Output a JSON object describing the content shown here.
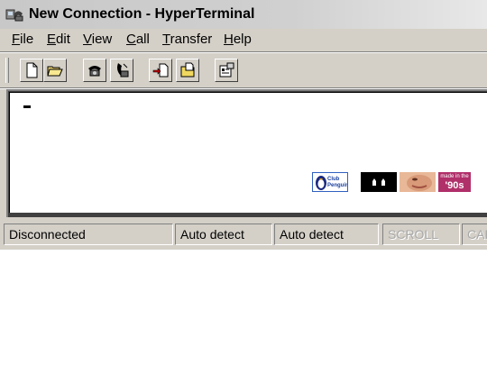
{
  "window": {
    "title": "New Connection - HyperTerminal",
    "app_icon": "hyperterminal-phone-icon"
  },
  "menubar": {
    "items": [
      {
        "label": "File",
        "accelerator": "F",
        "rest": "ile"
      },
      {
        "label": "Edit",
        "accelerator": "E",
        "rest": "dit"
      },
      {
        "label": "View",
        "accelerator": "V",
        "rest": "iew"
      },
      {
        "label": "Call",
        "accelerator": "C",
        "rest": "all"
      },
      {
        "label": "Transfer",
        "accelerator": "T",
        "rest": "ransfer"
      },
      {
        "label": "Help",
        "accelerator": "H",
        "rest": "elp"
      }
    ]
  },
  "toolbar": {
    "buttons": [
      {
        "name": "new-connection-button",
        "icon": "new-document-icon"
      },
      {
        "name": "open-button",
        "icon": "open-folder-icon"
      },
      {
        "name": "call-button",
        "icon": "phone-icon"
      },
      {
        "name": "disconnect-button",
        "icon": "hangup-phone-icon"
      },
      {
        "name": "send-file-button",
        "icon": "send-file-icon"
      },
      {
        "name": "receive-file-button",
        "icon": "receive-file-icon"
      },
      {
        "name": "properties-button",
        "icon": "properties-icon"
      }
    ]
  },
  "terminal": {
    "badges": [
      {
        "name": "club-penguin-badge",
        "text": "Club Penguin",
        "bg": "#ffffff"
      },
      {
        "name": "cat-eyes-badge",
        "text": "",
        "bg": "#000000"
      },
      {
        "name": "face-badge",
        "text": "",
        "bg": "#e8b898"
      },
      {
        "name": "made-in-90s-badge",
        "top": "made in the",
        "bottom": "'90s",
        "bg": "#b0306a"
      }
    ]
  },
  "statusbar": {
    "connection": "Disconnected",
    "detect1": "Auto detect",
    "detect2": "Auto detect",
    "scroll": "SCROLL",
    "caps": "CAPS"
  }
}
